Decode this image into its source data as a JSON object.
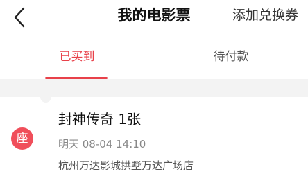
{
  "header": {
    "title": "我的电影票",
    "add_coupon_label": "添加兑换券",
    "back_icon": "chevron-left-icon"
  },
  "tabs": [
    {
      "label": "已买到",
      "active": true
    },
    {
      "label": "待付款",
      "active": false
    }
  ],
  "ticket": {
    "seat_badge": "座",
    "movie_title": "封神传奇 1张",
    "show_time": "明天 08-04 14:10",
    "cinema": "杭州万达影城拱墅万达广场店"
  },
  "colors": {
    "accent": "#e8414a",
    "badge": "#f04e5a",
    "background": "#f3f3f3"
  }
}
